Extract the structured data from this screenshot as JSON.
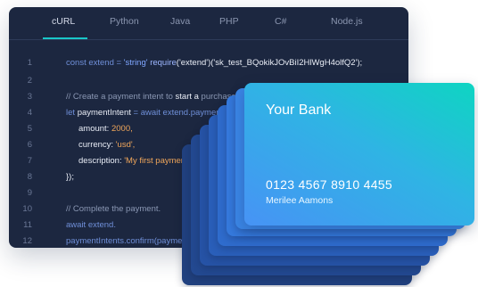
{
  "tabs": [
    {
      "label": "cURL",
      "active": true
    },
    {
      "label": "Python"
    },
    {
      "label": "Java"
    },
    {
      "label": "PHP"
    },
    {
      "label": "C#"
    },
    {
      "label": "Node.js"
    }
  ],
  "code": {
    "line_numbers": [
      "1",
      "2",
      "3",
      "4",
      "5",
      "6",
      "7",
      "8",
      "9",
      "10",
      "11",
      "12"
    ],
    "line1": {
      "kw": "const extend = ",
      "str": "'string' ",
      "func": "require",
      "rest": "('extend')('sk_test_BQokikJOvBiI2HlWgH4olfQ2');"
    },
    "line3": {
      "comment": "// Create a payment intent to ",
      "hl": "start a",
      "rest": " purchase flo"
    },
    "line4": {
      "kw": "let ",
      "var": "paymentIntent",
      "rest": " = await extend.payment"
    },
    "line5": {
      "key": "amount: ",
      "val": "2000,"
    },
    "line6": {
      "key": "currency: ",
      "val": "'usd',"
    },
    "line7": {
      "key": "description: ",
      "val": "'My first payment'"
    },
    "line8": {
      "text": "});"
    },
    "line10": {
      "comment": "// Complete the payment."
    },
    "line11": {
      "text": "await extend."
    },
    "line12": {
      "text": "paymentIntents.confirm(payme"
    }
  },
  "card": {
    "bank_name": "Your Bank",
    "number": "0123 4567 8910 4455",
    "holder": "Merilee Aamons"
  },
  "colors": {
    "editor_bg": "#1c2740",
    "accent": "#19c6c8",
    "card_gradient_start": "#0ed5c2",
    "card_gradient_end": "#4793f5"
  }
}
